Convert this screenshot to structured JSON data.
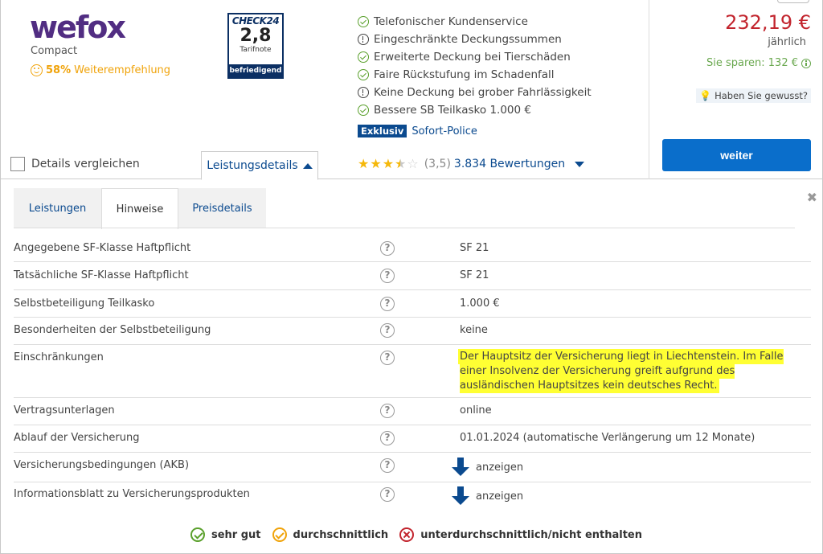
{
  "provider": {
    "logo_text": "wefox",
    "tariff": "Compact",
    "recommendation_pct": "58%",
    "recommendation_label": "Weiterempfehlung"
  },
  "seal": {
    "brand": "CHECK24",
    "grade": "2,8",
    "grade_label": "Tarifnote",
    "verdict": "befriedigend"
  },
  "features": [
    {
      "text": "Telefonischer Kundenservice",
      "status": "check"
    },
    {
      "text": "Eingeschränkte Deckungssummen",
      "status": "exclamation"
    },
    {
      "text": "Erweiterte Deckung bei Tierschäden",
      "status": "check"
    },
    {
      "text": "Faire Rückstufung im Schadenfall",
      "status": "check"
    },
    {
      "text": "Keine Deckung bei grober Fahrlässigkeit",
      "status": "exclamation"
    },
    {
      "text": "Bessere SB Teilkasko 1.000 €",
      "status": "check"
    }
  ],
  "exklusiv": {
    "badge": "Exklusiv",
    "text": "Sofort-Police"
  },
  "compare_label": "Details vergleichen",
  "details_tab_label": "Leistungsdetails",
  "rating": {
    "stars": 3.5,
    "score_text": "(3,5)",
    "count_text": "3.834 Bewertungen"
  },
  "pricing": {
    "price": "232,19 €",
    "period": "jährlich",
    "saving": "Sie sparen: 132 €",
    "tip": "Haben Sie gewusst?",
    "cta": "weiter"
  },
  "tabs": [
    {
      "label": "Leistungen",
      "active": false
    },
    {
      "label": "Hinweise",
      "active": true
    },
    {
      "label": "Preisdetails",
      "active": false
    }
  ],
  "rows": [
    {
      "label": "Angegebene SF-Klasse Haftpflicht",
      "value": "SF 21"
    },
    {
      "label": "Tatsächliche SF-Klasse Haftpflicht",
      "value": "SF 21"
    },
    {
      "label": "Selbstbeteiligung Teilkasko",
      "value": "1.000 €"
    },
    {
      "label": "Besonderheiten der Selbstbeteiligung",
      "value": "keine"
    },
    {
      "label": "Einschränkungen",
      "value": "Der Hauptsitz der Versicherung liegt in Liechtenstein. Im Falle einer Insolvenz der Versicherung greift aufgrund des ausländischen Hauptsitzes kein deutsches Recht."
    },
    {
      "label": "Vertragsunterlagen",
      "value": "online"
    },
    {
      "label": "Ablauf der Versicherung",
      "value": "01.01.2024 (automatische Verlängerung um 12 Monate)"
    },
    {
      "label": "Versicherungsbedingungen (AKB)",
      "value": "anzeigen"
    },
    {
      "label": "Informationsblatt zu Versicherungsprodukten",
      "value": "anzeigen"
    }
  ],
  "help_glyph": "?",
  "close_glyph": "✖",
  "legend": [
    {
      "label": "sehr gut",
      "type": "good"
    },
    {
      "label": "durchschnittlich",
      "type": "average"
    },
    {
      "label": "unterdurchschnittlich/nicht enthalten",
      "type": "bad"
    }
  ],
  "colors": {
    "brand_purple": "#512d82",
    "price_red": "#c2242d",
    "saving_green": "#6aa84f",
    "link_blue": "#0b4a8f",
    "cta_blue": "#0a6ecb",
    "highlight_yellow": "#ffff33"
  }
}
